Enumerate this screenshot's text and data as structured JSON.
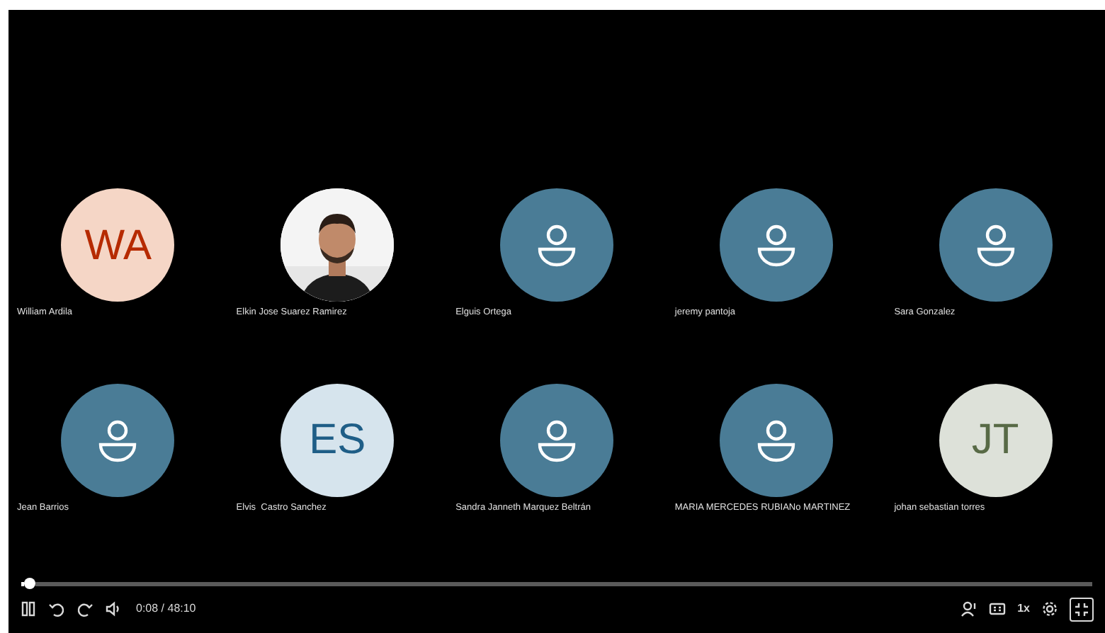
{
  "participants": [
    {
      "name": "William Ardila",
      "avatar": {
        "kind": "initials",
        "text": "WA",
        "color": "#f5d6c6"
      }
    },
    {
      "name": "Elkin Jose Suarez Ramirez"
    },
    {
      "name": "Elguis Ortega",
      "avatar": {
        "kind": "default"
      }
    },
    {
      "name": "jeremy pantoja",
      "avatar": {
        "kind": "default"
      }
    },
    {
      "name": "Sara Gonzalez",
      "avatar": {
        "kind": "default"
      }
    },
    {
      "name": "Jean Barrios",
      "avatar": {
        "kind": "default"
      }
    },
    {
      "name": "Elvis  Castro Sanchez",
      "avatar": {
        "kind": "initials",
        "text": "ES",
        "color": "#d6e4ed"
      }
    },
    {
      "name": "Sandra Janneth Marquez Beltrán",
      "avatar": {
        "kind": "default"
      }
    },
    {
      "name": "MARIA MERCEDES RUBIANo MARTINEZ",
      "avatar": {
        "kind": "default"
      }
    },
    {
      "name": "johan sebastian torres",
      "avatar": {
        "kind": "initials",
        "text": "JT",
        "color": "#dde1d9"
      }
    }
  ],
  "player": {
    "progress": {
      "level": 0.003
    },
    "playing": true,
    "time": "0:08 / 48:10",
    "speed": "1x"
  }
}
